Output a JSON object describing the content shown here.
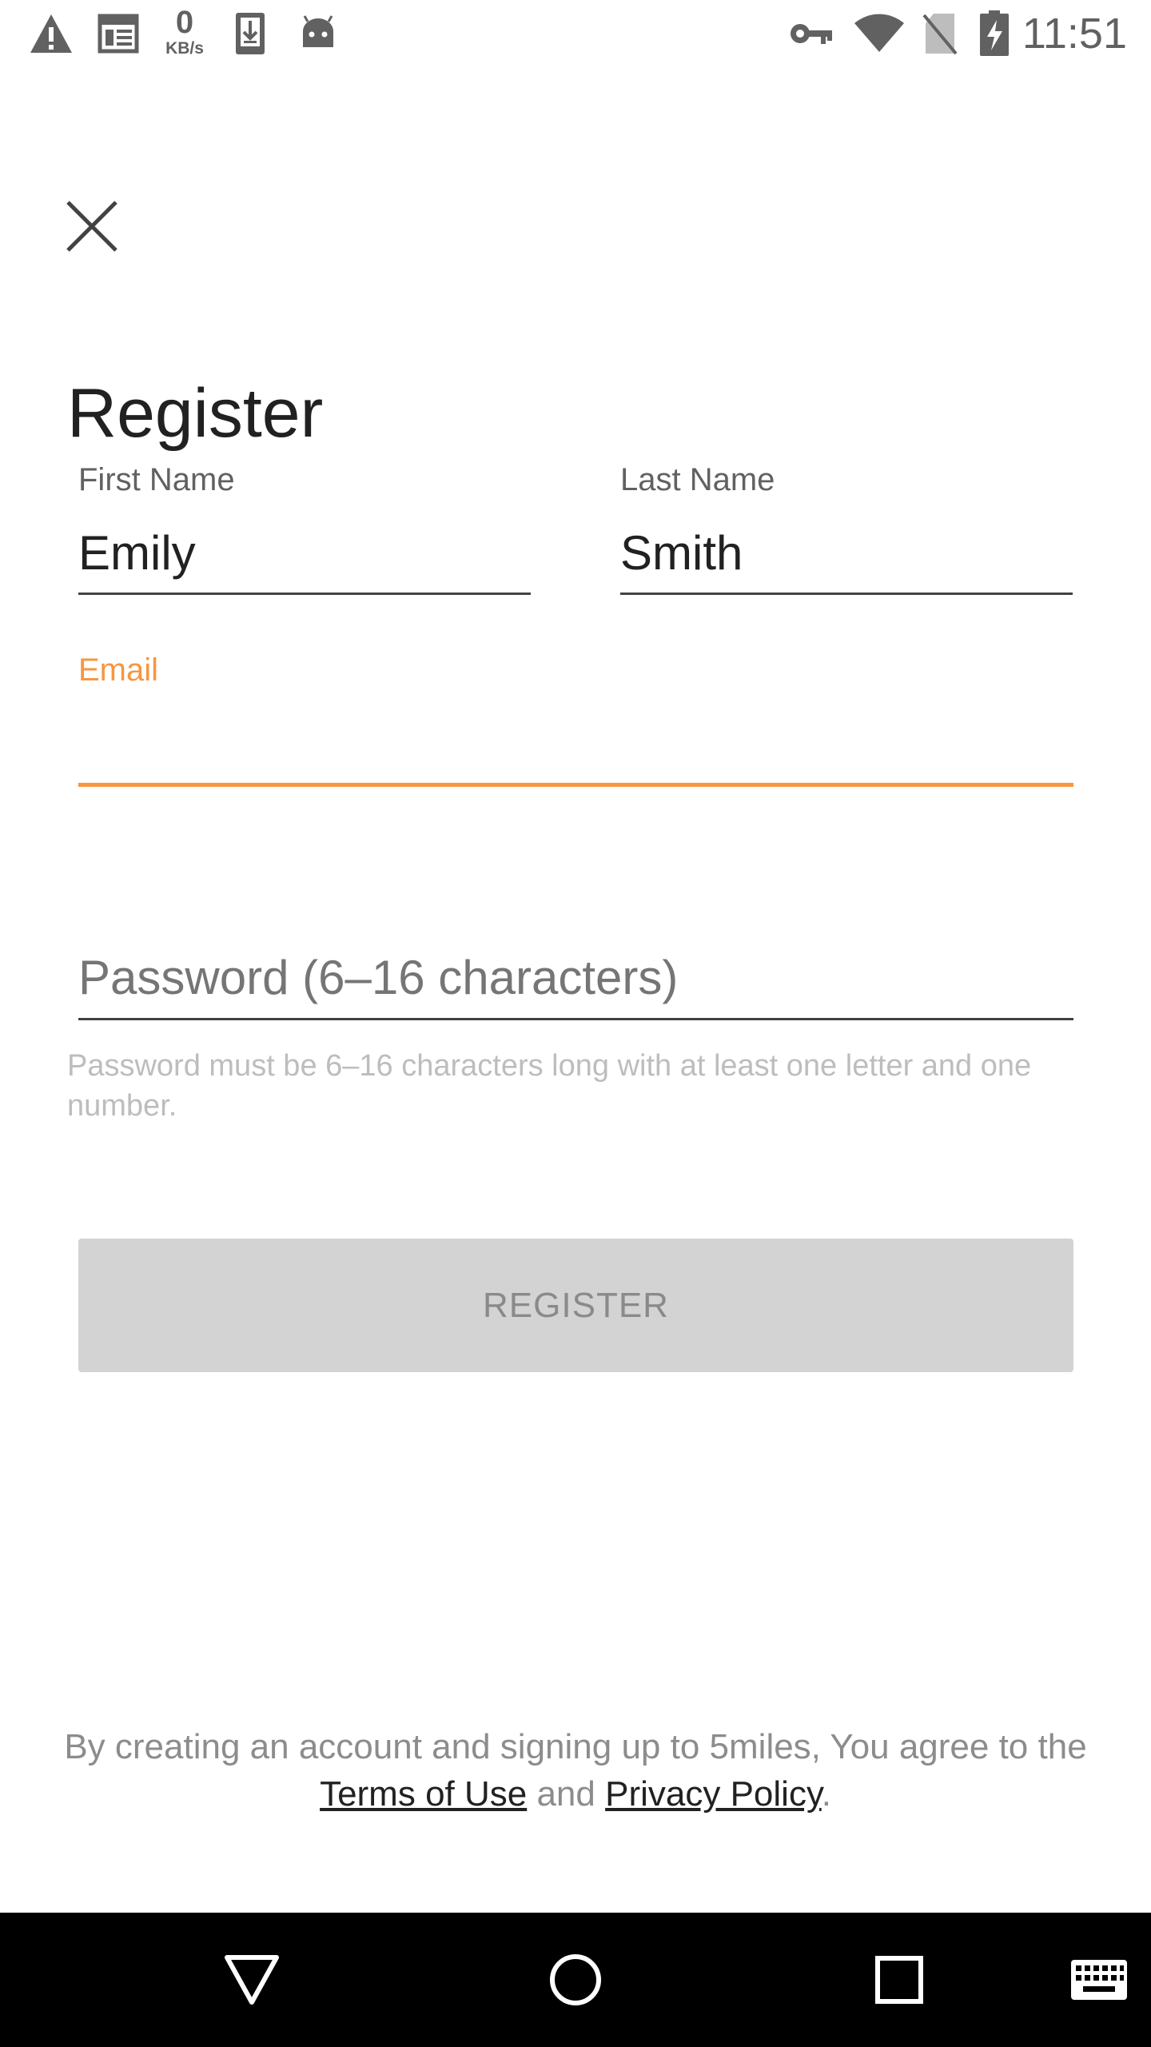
{
  "status_bar": {
    "time": "11:51",
    "net_speed_value": "0",
    "net_speed_unit": "KB/s",
    "left_icons": [
      "warning-icon",
      "news-icon",
      "net-speed-icon",
      "download-icon",
      "android-icon"
    ],
    "right_icons": [
      "vpn-key-icon",
      "wifi-icon",
      "no-sim-icon",
      "battery-charging-icon"
    ]
  },
  "header": {
    "title": "Register"
  },
  "form": {
    "first_name": {
      "label": "First Name",
      "value": "Emily"
    },
    "last_name": {
      "label": "Last Name",
      "value": "Smith"
    },
    "email": {
      "label": "Email",
      "value": ""
    },
    "password": {
      "placeholder": "Password (6–16 characters)",
      "value": ""
    },
    "password_helper": "Password must be 6–16 characters long with at least one letter and one number."
  },
  "actions": {
    "register_label": "REGISTER",
    "register_enabled": false
  },
  "footer": {
    "terms_prefix": "By creating an account and signing up to 5miles, You agree to the ",
    "terms_link": "Terms of Use",
    "terms_and": " and ",
    "privacy_link": "Privacy Policy",
    "terms_suffix": "."
  },
  "nav_bar": {
    "buttons": [
      "back-icon",
      "home-icon",
      "recents-icon",
      "keyboard-icon"
    ]
  },
  "colors": {
    "accent": "#F7963F",
    "text_primary": "#212121",
    "text_secondary": "#616161",
    "helper": "#BDBDBD",
    "button_disabled_bg": "#D3D3D3",
    "button_disabled_text": "#8A8A8A"
  }
}
